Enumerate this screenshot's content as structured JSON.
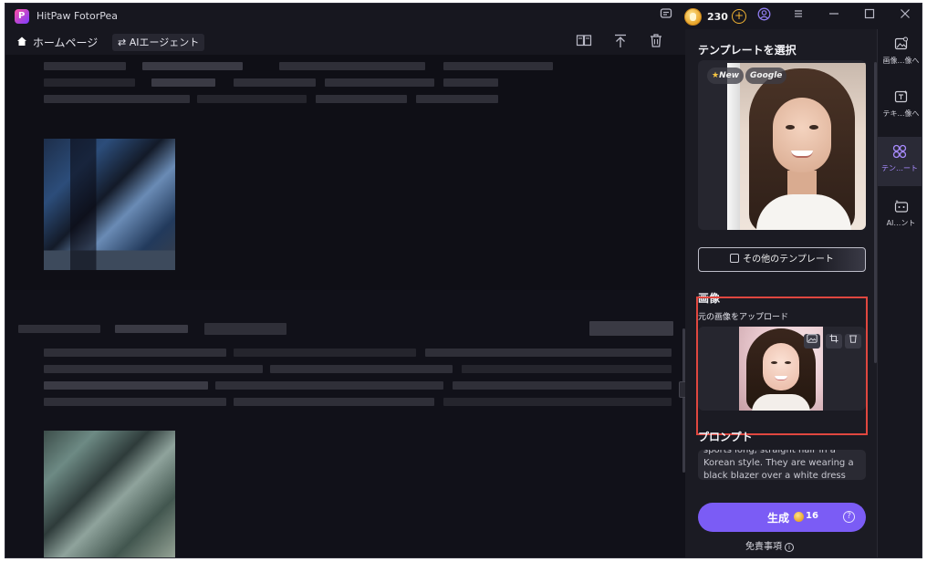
{
  "titlebar": {
    "app_name": "HitPaw FotorPea",
    "logo_letter": "P",
    "credits": "230",
    "icons": [
      "chat-icon",
      "coin-icon",
      "add-credits-icon",
      "user-icon",
      "menu-icon",
      "minimize-icon",
      "maximize-icon",
      "close-icon"
    ]
  },
  "toolbar": {
    "home_label": "ホームページ",
    "agent_label": "⇄ AIエージェント",
    "icons": [
      "book-icon",
      "upload-icon",
      "trash-icon"
    ]
  },
  "panel": {
    "template_title": "テンプレートを選択",
    "tag_new": "New",
    "tag_google": "Google",
    "more_templates": "その他のテンプレート",
    "image_title": "画像",
    "upload_label": "元の画像をアップロード",
    "prompt_title": "プロンプト",
    "prompt_text": "sports long, straight hair in a Korean style. They are wearing a black blazer over a white dress shirt",
    "generate_label": "生成",
    "generate_cost": "16",
    "disclaimer": "免責事項"
  },
  "rail": {
    "items": [
      {
        "label": "画像…像へ",
        "icon": "image-icon"
      },
      {
        "label": "テキ…像へ",
        "icon": "text-to-image-icon"
      },
      {
        "label": "テン…ート",
        "icon": "template-icon"
      },
      {
        "label": "AI…ント",
        "icon": "ai-agent-icon"
      }
    ]
  },
  "colors": {
    "accent": "#7b5cf5",
    "highlight": "#e0473f",
    "background": "#15151d",
    "coin": "#e8a52a"
  }
}
